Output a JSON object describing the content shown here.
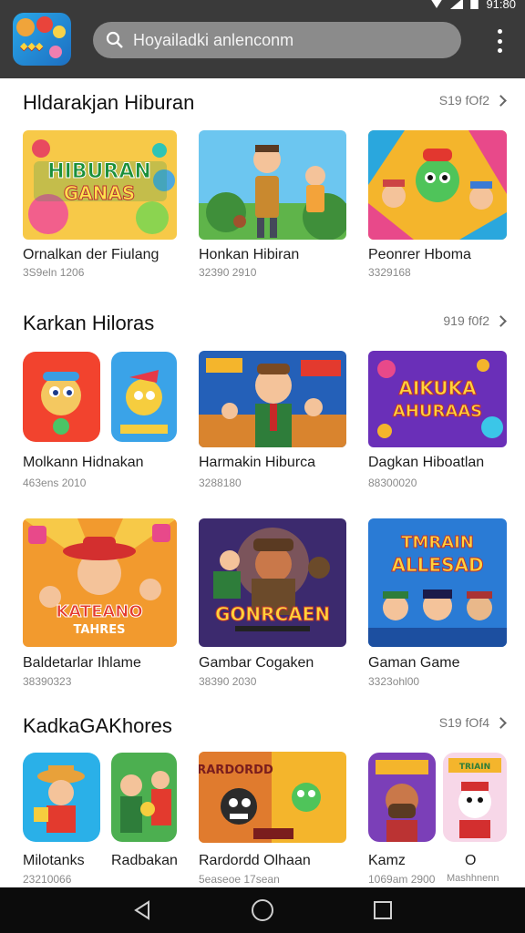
{
  "status": {
    "time": "91:80"
  },
  "search": {
    "placeholder": "Hoyailadki anlenconm"
  },
  "sections": [
    {
      "title": "Hldarakjan Hiburan",
      "more": "S19 fOf2",
      "cards": [
        {
          "title": "Ornalkan der Fiulang",
          "sub": "3S9eln 1206",
          "art": "HIBURAN GANAS"
        },
        {
          "title": "Honkan Hibiran",
          "sub": "32390 2910",
          "art": ""
        },
        {
          "title": "Peonrer Hboma",
          "sub": "3329168",
          "art": ""
        }
      ]
    },
    {
      "title": "Karkan Hiloras",
      "more": "919 f0f2",
      "cards": [
        {
          "title": "Molkann Hidnakan",
          "sub": "463ens 2010",
          "art": ""
        },
        {
          "title": "Harmakin Hiburca",
          "sub": "3288180",
          "art": ""
        },
        {
          "title": "Dagkan Hiboatlan",
          "sub": "88300020",
          "art": "AIKUKA AHURAAS"
        }
      ]
    },
    {
      "title": "",
      "more": "",
      "cards": [
        {
          "title": "Baldetarlar Ihlame",
          "sub": "38390323",
          "art": "KATEANO TAHRES"
        },
        {
          "title": "Gambar Cogaken",
          "sub": "38390 2030",
          "art": "GONRCAEN"
        },
        {
          "title": "Gaman Game",
          "sub": "3323ohl00",
          "art": "TMRAIN ALLESAD"
        }
      ]
    },
    {
      "title": "KadkaGAKhores",
      "more": "S19 fOf4",
      "cards": [
        {
          "title": "Milotanks",
          "sub": "23210066",
          "art": ""
        },
        {
          "title": "Radbakan",
          "sub": "",
          "art": ""
        },
        {
          "title": "Rardordd Olhaan",
          "sub": "5easeoe 17sean",
          "art": "RARDORDD"
        },
        {
          "title": "Kamz",
          "sub": "1069am 2900",
          "art": ""
        },
        {
          "title": "O",
          "sub": "Mashhnenn",
          "art": "TRIAIN"
        }
      ]
    }
  ],
  "colors": {
    "topbar": "#3a3a3a",
    "search": "#8b8b8b",
    "navbar": "#0c0c0c"
  }
}
